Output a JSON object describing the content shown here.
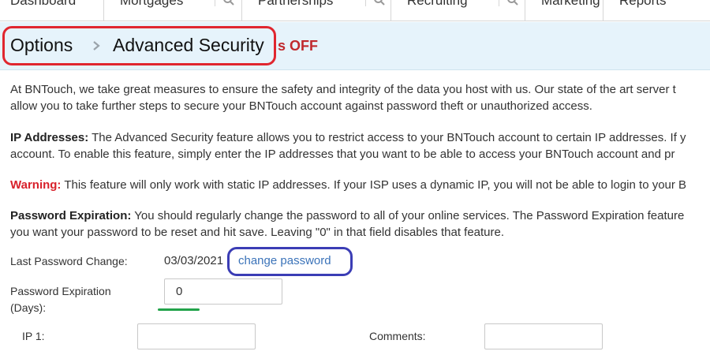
{
  "nav": {
    "tabs": [
      {
        "label": "Dashboard",
        "has_menu": false
      },
      {
        "label": "Mortgages",
        "has_menu": true
      },
      {
        "label": "Partnerships",
        "has_menu": true
      },
      {
        "label": "Recruiting",
        "has_menu": true
      },
      {
        "label": "Marketing",
        "has_menu": false
      },
      {
        "label": "Reports",
        "has_menu": false
      }
    ]
  },
  "breadcrumb": {
    "root": "Options",
    "current": "Advanced Security"
  },
  "status_text": "s OFF",
  "paragraphs": {
    "intro": {
      "line1": "At BNTouch, we take great measures to ensure the safety and integrity of the data you host with us. Our state of the art server t",
      "line2": "allow you to take further steps to secure your BNTouch account against password theft or unauthorized access."
    },
    "ip": {
      "lead": "IP Addresses:",
      "line1_rest": " The Advanced Security feature allows you to restrict access to your BNTouch account to certain IP addresses. If y",
      "line2": "account. To enable this feature, simply enter the IP addresses that you want to be able to access your BNTouch account and pr"
    },
    "warning": {
      "lead": "Warning:",
      "rest": " This feature will only work with static IP addresses. If your ISP uses a dynamic IP, you will not be able to login to your B"
    },
    "expiration": {
      "lead": "Password Expiration:",
      "line1_rest": " You should regularly change the password to all of your online services. The Password Expiration feature",
      "line2": "you want your password to be reset and hit save. Leaving \"0\" in that field disables that feature."
    }
  },
  "form": {
    "last_change_label": "Last Password Change:",
    "last_change_value": "03/03/2021",
    "change_password_link": "change password",
    "expiration_label_line1": "Password Expiration",
    "expiration_label_line2": "(Days):",
    "expiration_value": "0",
    "ip1_label": "IP 1:",
    "ip1_value": "",
    "comments_label": "Comments:",
    "comments_value": ""
  },
  "colors": {
    "header_band": "#e6f3fb",
    "status_red": "#c0292d",
    "warning_red": "#d8212b",
    "link_blue": "#3b73b9",
    "annotation_red": "#e0262f",
    "annotation_blue": "#3b3db5",
    "annotation_green": "#22a34a"
  },
  "icons": {
    "breadcrumb_separator": "chevron-right-icon",
    "nav_menu": "search-icon"
  }
}
